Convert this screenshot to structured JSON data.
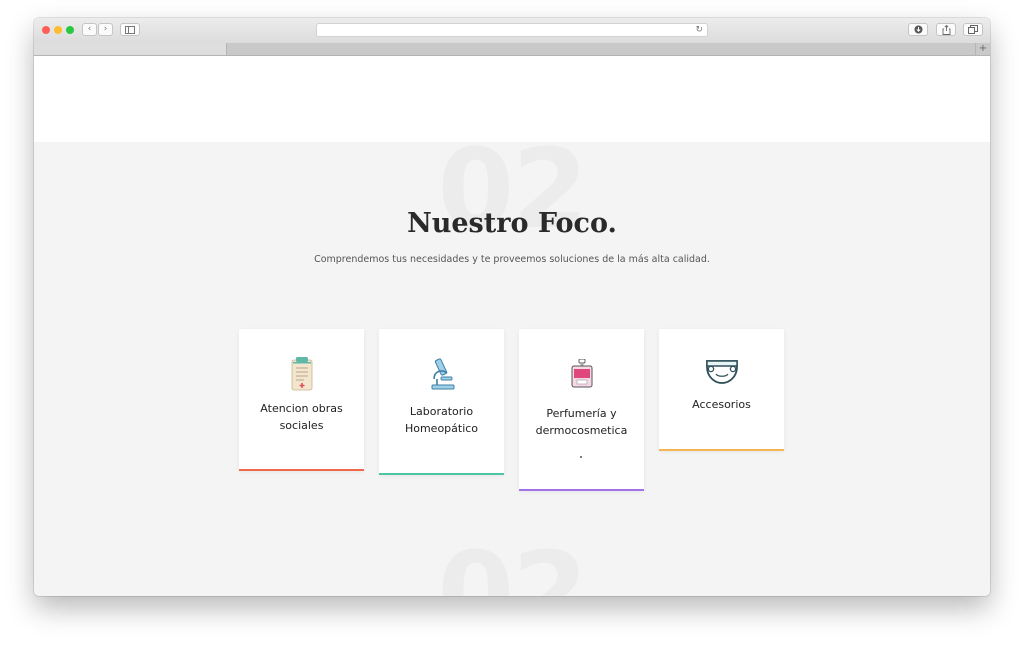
{
  "browser": {
    "back_icon": "chevron-left",
    "forward_icon": "chevron-right",
    "sidebar_icon": "sidebar",
    "reload_icon": "reload",
    "new_tab_label": "+"
  },
  "section": {
    "bg_number": "02",
    "title": "Nuestro Foco.",
    "subtitle": "Comprendemos tus necesidades y te proveemos soluciones de la más alta calidad."
  },
  "cards": [
    {
      "label_1": "Atencion obras",
      "label_2": "sociales",
      "icon": "clipboard-icon",
      "accent": "#f0684a"
    },
    {
      "label_1": "Laboratorio",
      "label_2": "Homeopático",
      "icon": "microscope-icon",
      "accent": "#4ec4a6"
    },
    {
      "label_1": "Perfumería y",
      "label_2": "dermocosmetica",
      "icon": "perfume-icon",
      "accent": "#a472e8"
    },
    {
      "label_1": "Accesorios",
      "label_2": "",
      "icon": "diaper-icon",
      "accent": "#f5b555"
    }
  ]
}
